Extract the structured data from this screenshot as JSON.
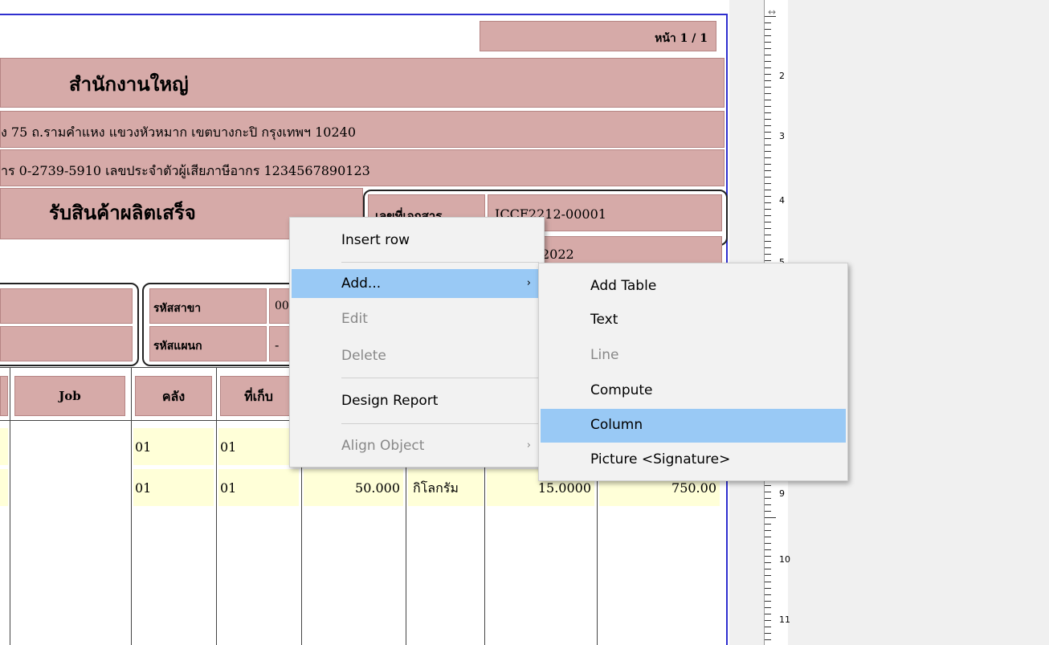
{
  "report": {
    "page_label": "หน้า 1 / 1",
    "company_name": "สำนักงานใหญ่",
    "address_line": "ง 75 ถ.รามคำแหง แขวงหัวหมาก เขตบางกะปิ กรุงเทพฯ 10240",
    "phone_tax_line": "าร 0-2739-5910  เลขประจำตัวผู้เสียภาษีอากร 1234567890123",
    "doc_title": "รับสินค้าผลิตเสร็จ",
    "doc_no_label": "เลขที่เอกสาร",
    "doc_no_value": "ICCF2212-00001",
    "doc_date_value": "2022",
    "branch_label": "รหัสสาขา",
    "branch_value": "00",
    "dept_label": "รหัสแผนก",
    "dept_value": "-",
    "columns": {
      "job": "Job",
      "warehouse": "คลัง",
      "location": "ที่เก็บ"
    },
    "rows": [
      {
        "warehouse": "01",
        "location": "01",
        "qty": "",
        "unit": "",
        "price": "",
        "amount": ""
      },
      {
        "warehouse": "01",
        "location": "01",
        "qty": "50.000",
        "unit": "กิโลกรัม",
        "price": "15.0000",
        "amount": "750.00"
      }
    ]
  },
  "ruler": {
    "labels": [
      "2",
      "3",
      "4",
      "5",
      "9",
      "10",
      "11"
    ]
  },
  "context_menu": {
    "items": [
      {
        "label": "Insert row",
        "state": "normal"
      },
      {
        "label": "Add...",
        "state": "highlighted",
        "submenu": true
      },
      {
        "label": "Edit",
        "state": "disabled"
      },
      {
        "label": "Delete",
        "state": "disabled"
      },
      {
        "label": "Design Report",
        "state": "normal"
      },
      {
        "label": "Align Object",
        "state": "disabled",
        "submenu": true
      }
    ]
  },
  "submenu": {
    "items": [
      {
        "label": "Add Table",
        "state": "normal"
      },
      {
        "label": "Text",
        "state": "normal"
      },
      {
        "label": "Line",
        "state": "disabled"
      },
      {
        "label": "Compute",
        "state": "normal"
      },
      {
        "label": "Column",
        "state": "highlighted"
      },
      {
        "label": "Picture <Signature>",
        "state": "normal"
      }
    ]
  },
  "colors": {
    "field_fill": "#d6aaa8",
    "row_fill": "#ffffd8",
    "page_border": "#2f2fcf",
    "menu_highlight": "#99c9f5"
  }
}
